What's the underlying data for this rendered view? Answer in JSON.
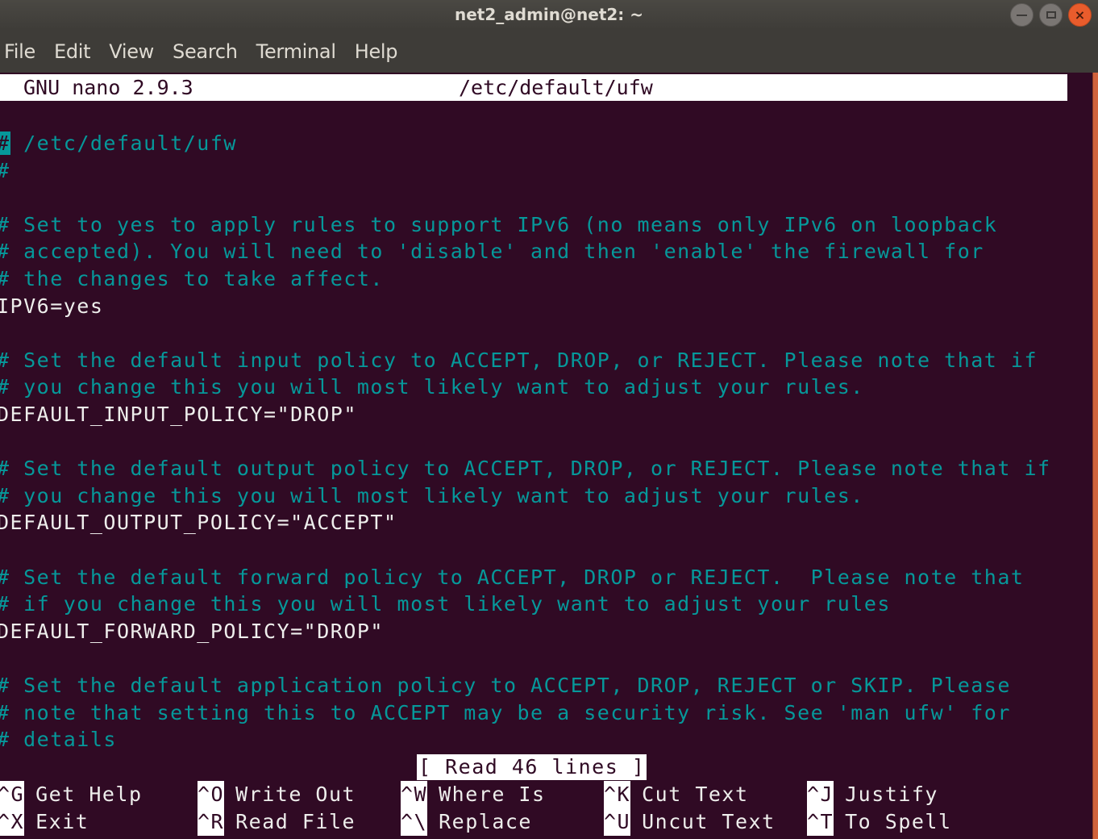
{
  "window": {
    "title": "net2_admin@net2: ~",
    "buttons": [
      {
        "name": "minimize",
        "icon": "minimize-icon"
      },
      {
        "name": "maximize",
        "icon": "maximize-icon"
      },
      {
        "name": "close",
        "icon": "close-icon",
        "glyph": "×"
      }
    ]
  },
  "menubar": {
    "items": [
      "File",
      "Edit",
      "View",
      "Search",
      "Terminal",
      "Help"
    ]
  },
  "nano": {
    "version": "GNU nano 2.9.3",
    "filename": "/etc/default/ufw",
    "cursor_char": "#",
    "lines": [
      {
        "type": "comment",
        "text": " /etc/default/ufw",
        "cursor": true
      },
      {
        "type": "comment",
        "text": "#"
      },
      {
        "type": "blank",
        "text": ""
      },
      {
        "type": "comment",
        "text": "# Set to yes to apply rules to support IPv6 (no means only IPv6 on loopback"
      },
      {
        "type": "comment",
        "text": "# accepted). You will need to 'disable' and then 'enable' the firewall for"
      },
      {
        "type": "comment",
        "text": "# the changes to take affect."
      },
      {
        "type": "code",
        "text": "IPV6=yes"
      },
      {
        "type": "blank",
        "text": ""
      },
      {
        "type": "comment",
        "text": "# Set the default input policy to ACCEPT, DROP, or REJECT. Please note that if"
      },
      {
        "type": "comment",
        "text": "# you change this you will most likely want to adjust your rules."
      },
      {
        "type": "code",
        "text": "DEFAULT_INPUT_POLICY=\"DROP\""
      },
      {
        "type": "blank",
        "text": ""
      },
      {
        "type": "comment",
        "text": "# Set the default output policy to ACCEPT, DROP, or REJECT. Please note that if"
      },
      {
        "type": "comment",
        "text": "# you change this you will most likely want to adjust your rules."
      },
      {
        "type": "code",
        "text": "DEFAULT_OUTPUT_POLICY=\"ACCEPT\""
      },
      {
        "type": "blank",
        "text": ""
      },
      {
        "type": "comment",
        "text": "# Set the default forward policy to ACCEPT, DROP or REJECT.  Please note that"
      },
      {
        "type": "comment",
        "text": "# if you change this you will most likely want to adjust your rules"
      },
      {
        "type": "code",
        "text": "DEFAULT_FORWARD_POLICY=\"DROP\""
      },
      {
        "type": "blank",
        "text": ""
      },
      {
        "type": "comment",
        "text": "# Set the default application policy to ACCEPT, DROP, REJECT or SKIP. Please"
      },
      {
        "type": "comment",
        "text": "# note that setting this to ACCEPT may be a security risk. See 'man ufw' for"
      },
      {
        "type": "comment",
        "text": "# details"
      }
    ],
    "status": "[ Read 46 lines ]",
    "shortcuts": [
      {
        "key": "^G",
        "label": "Get Help"
      },
      {
        "key": "^X",
        "label": "Exit"
      },
      {
        "key": "^O",
        "label": "Write Out"
      },
      {
        "key": "^R",
        "label": "Read File"
      },
      {
        "key": "^W",
        "label": "Where Is"
      },
      {
        "key": "^\\",
        "label": "Replace"
      },
      {
        "key": "^K",
        "label": "Cut Text"
      },
      {
        "key": "^U",
        "label": "Uncut Text"
      },
      {
        "key": "^J",
        "label": "Justify"
      },
      {
        "key": "^T",
        "label": "To Spell"
      }
    ]
  },
  "colors": {
    "terminal_bg": "#300a24",
    "comment": "#06989a",
    "code": "#eeeeec",
    "scrollbar": "#d0623c",
    "close_button": "#e95c2c"
  }
}
